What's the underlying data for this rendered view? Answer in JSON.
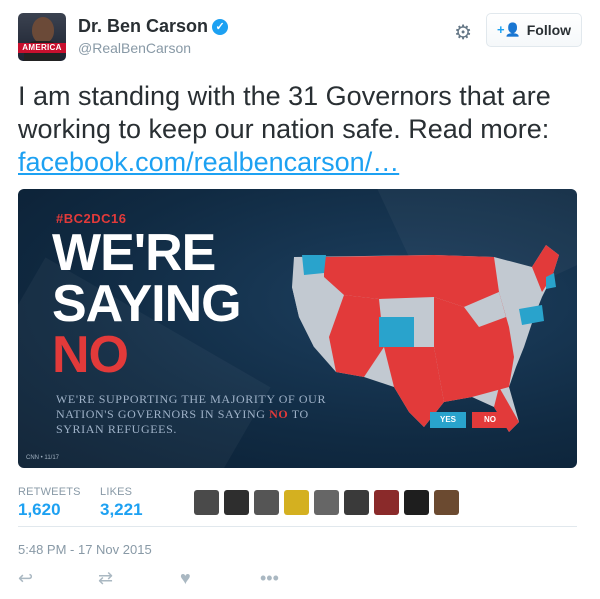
{
  "author": {
    "name": "Dr. Ben Carson",
    "handle": "@RealBenCarson",
    "avatar_text": "AMERICA",
    "verified": true
  },
  "follow_label": "Follow",
  "tweet": {
    "text": "I am standing with the 31 Governors that are working to keep our nation safe. Read more:",
    "link": "facebook.com/realbencarson/…"
  },
  "media": {
    "tag": "#BC2DC16",
    "title_line1": "WE'RE",
    "title_line2": "SAYING",
    "title_line3": "NO",
    "subtitle_part1": "WE'RE SUPPORTING THE MAJORITY OF OUR NATION'S GOVERNORS IN SAYING",
    "subtitle_no": "NO",
    "subtitle_part2": "TO SYRIAN REFUGEES.",
    "legend_yes": "YES",
    "legend_no": "NO",
    "credit": "CNN • 11/17",
    "colors": {
      "yes": "#29a3cc",
      "no": "#e23a3a",
      "neutral": "#c2c9d1"
    }
  },
  "stats": {
    "retweets_label": "RETWEETS",
    "retweets_value": "1,620",
    "likes_label": "LIKES",
    "likes_value": "3,221"
  },
  "timestamp": "5:48 PM - 17 Nov 2015",
  "icons": {
    "reply": "reply-icon",
    "retweet": "retweet-icon",
    "like": "heart-icon",
    "more": "more-icon",
    "settings": "gear-icon"
  }
}
